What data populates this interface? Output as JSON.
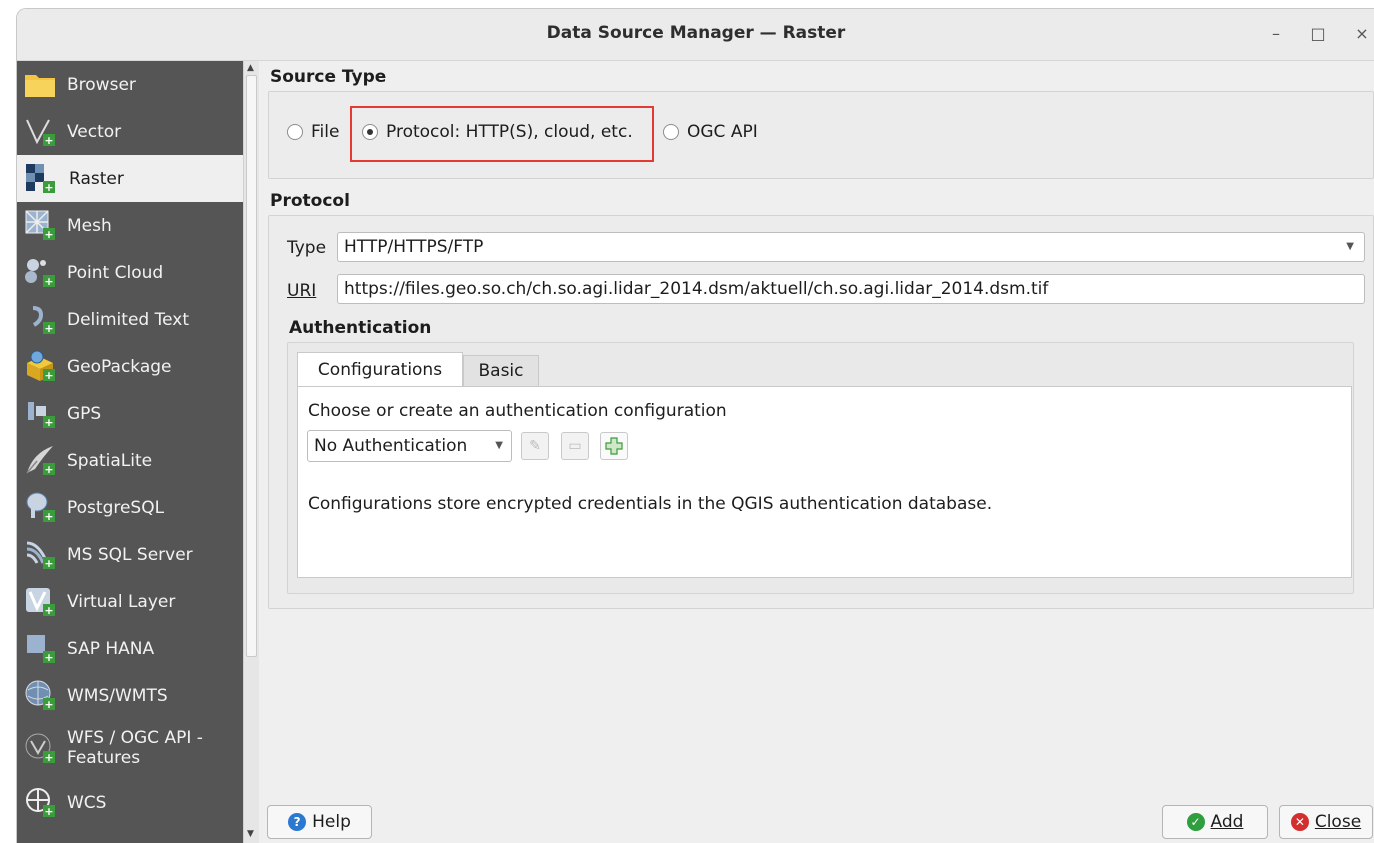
{
  "window": {
    "title": "Data Source Manager — Raster"
  },
  "window_controls": {
    "minimize": "–",
    "maximize": "□",
    "close": "×"
  },
  "sidebar": {
    "items": [
      {
        "label": "Browser",
        "icon": "folder-icon"
      },
      {
        "label": "Vector",
        "icon": "vector-icon"
      },
      {
        "label": "Raster",
        "icon": "raster-icon",
        "active": true
      },
      {
        "label": "Mesh",
        "icon": "mesh-icon"
      },
      {
        "label": "Point Cloud",
        "icon": "point-cloud-icon"
      },
      {
        "label": "Delimited Text",
        "icon": "delimited-text-icon"
      },
      {
        "label": "GeoPackage",
        "icon": "geopackage-icon"
      },
      {
        "label": "GPS",
        "icon": "gps-icon"
      },
      {
        "label": "SpatiaLite",
        "icon": "spatialite-icon"
      },
      {
        "label": "PostgreSQL",
        "icon": "postgresql-icon"
      },
      {
        "label": "MS SQL Server",
        "icon": "mssql-icon"
      },
      {
        "label": "Virtual Layer",
        "icon": "virtual-layer-icon"
      },
      {
        "label": "SAP HANA",
        "icon": "sap-hana-icon"
      },
      {
        "label": "WMS/WMTS",
        "icon": "wms-icon"
      },
      {
        "label": "WFS / OGC API - Features",
        "icon": "wfs-icon"
      },
      {
        "label": "WCS",
        "icon": "wcs-icon"
      }
    ]
  },
  "source_type": {
    "title": "Source Type",
    "options": [
      {
        "label": "File",
        "selected": false
      },
      {
        "label": "Protocol: HTTP(S), cloud, etc.",
        "selected": true
      },
      {
        "label": "OGC API",
        "selected": false
      }
    ]
  },
  "protocol": {
    "title": "Protocol",
    "type_label": "Type",
    "type_value": "HTTP/HTTPS/FTP",
    "uri_label": "URI",
    "uri_value": "https://files.geo.so.ch/ch.so.agi.lidar_2014.dsm/aktuell/ch.so.agi.lidar_2014.dsm.tif"
  },
  "authentication": {
    "title": "Authentication",
    "tabs": [
      "Configurations",
      "Basic"
    ],
    "prompt": "Choose or create an authentication configuration",
    "config_value": "No Authentication",
    "info": "Configurations store encrypted credentials in the QGIS authentication database."
  },
  "buttons": {
    "help": "Help",
    "add": "Add",
    "close": "Close"
  },
  "colors": {
    "sidebar_bg": "#555555",
    "highlight": "#e53935",
    "add_green": "#2e9e3e",
    "close_red": "#d32f2f",
    "help_blue": "#2b78d0"
  }
}
